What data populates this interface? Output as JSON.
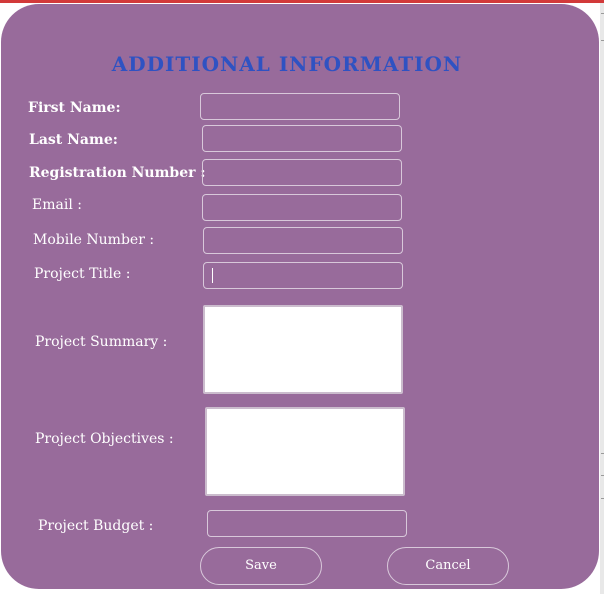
{
  "form": {
    "title": "ADDITIONAL INFORMATION",
    "fields": {
      "first_name": {
        "label": "First Name:",
        "value": ""
      },
      "last_name": {
        "label": "Last Name:",
        "value": ""
      },
      "registration_number": {
        "label": "Registration Number :",
        "value": ""
      },
      "email": {
        "label": "Email :",
        "value": ""
      },
      "mobile_number": {
        "label": "Mobile Number :",
        "value": ""
      },
      "project_title": {
        "label": "Project Title :",
        "value": ""
      },
      "project_summary": {
        "label": "Project Summary :",
        "value": ""
      },
      "project_objectives": {
        "label": "Project Objectives :",
        "value": ""
      },
      "project_budget": {
        "label": "Project Budget :",
        "value": ""
      }
    },
    "buttons": {
      "save": "Save",
      "cancel": "Cancel"
    }
  },
  "colors": {
    "panel_bg": "#986b9b",
    "title": "#2f52c2",
    "label": "#ffffff",
    "window_accent": "#d23a3a"
  }
}
